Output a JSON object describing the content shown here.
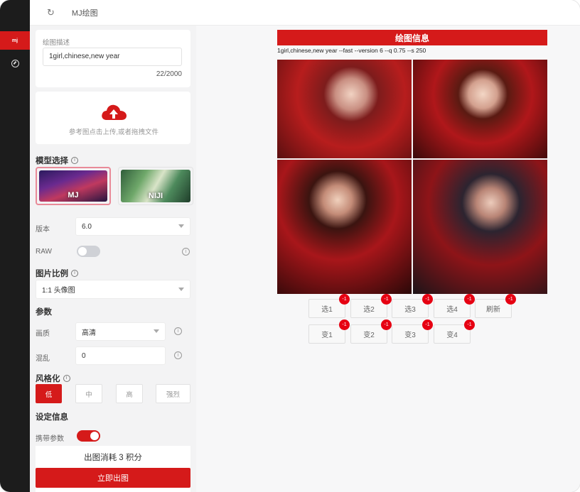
{
  "top": {
    "title": "MJ绘图"
  },
  "rail": {
    "logo_text": "mj"
  },
  "prompt": {
    "label": "绘图描述",
    "value": "1girl,chinese,new year",
    "counter": "22/2000"
  },
  "upload": {
    "text": "参考图点击上传,或者拖拽文件"
  },
  "model": {
    "title": "模型选择",
    "options": [
      {
        "label": "MJ",
        "selected": true
      },
      {
        "label": "NIJI",
        "selected": false
      }
    ]
  },
  "version": {
    "label": "版本",
    "value": "6.0"
  },
  "raw": {
    "label": "RAW",
    "enabled": false
  },
  "ratio": {
    "title": "图片比例",
    "value": "1:1 头像图"
  },
  "params": {
    "title": "参数",
    "quality": {
      "label": "画质",
      "value": "高清"
    },
    "chaos": {
      "label": "混乱",
      "value": "0"
    }
  },
  "stylize": {
    "title": "风格化",
    "options": [
      "低",
      "中",
      "高",
      "强烈"
    ],
    "selected": "低"
  },
  "settings": {
    "title": "设定信息",
    "carry_params": {
      "label": "携带参数",
      "enabled": true
    }
  },
  "footer": {
    "cost_text": "出图消耗 3 积分",
    "generate_label": "立即出图"
  },
  "result": {
    "header": "绘图信息",
    "prompt_line": "1girl,chinese,new year --fast --version 6 --q 0.75 --s 250",
    "upscale_buttons": [
      "选1",
      "选2",
      "选3",
      "选4",
      "刷新"
    ],
    "variation_buttons": [
      "变1",
      "变2",
      "变3",
      "变4"
    ],
    "badge": "-1"
  },
  "colors": {
    "accent": "#d51a1a",
    "rail": "#1c1c1c",
    "badge": "#e60012"
  },
  "icons": {
    "refresh": "refresh-icon",
    "upload": "cloud-upload-icon",
    "info": "info-icon",
    "compass": "compass-icon"
  }
}
